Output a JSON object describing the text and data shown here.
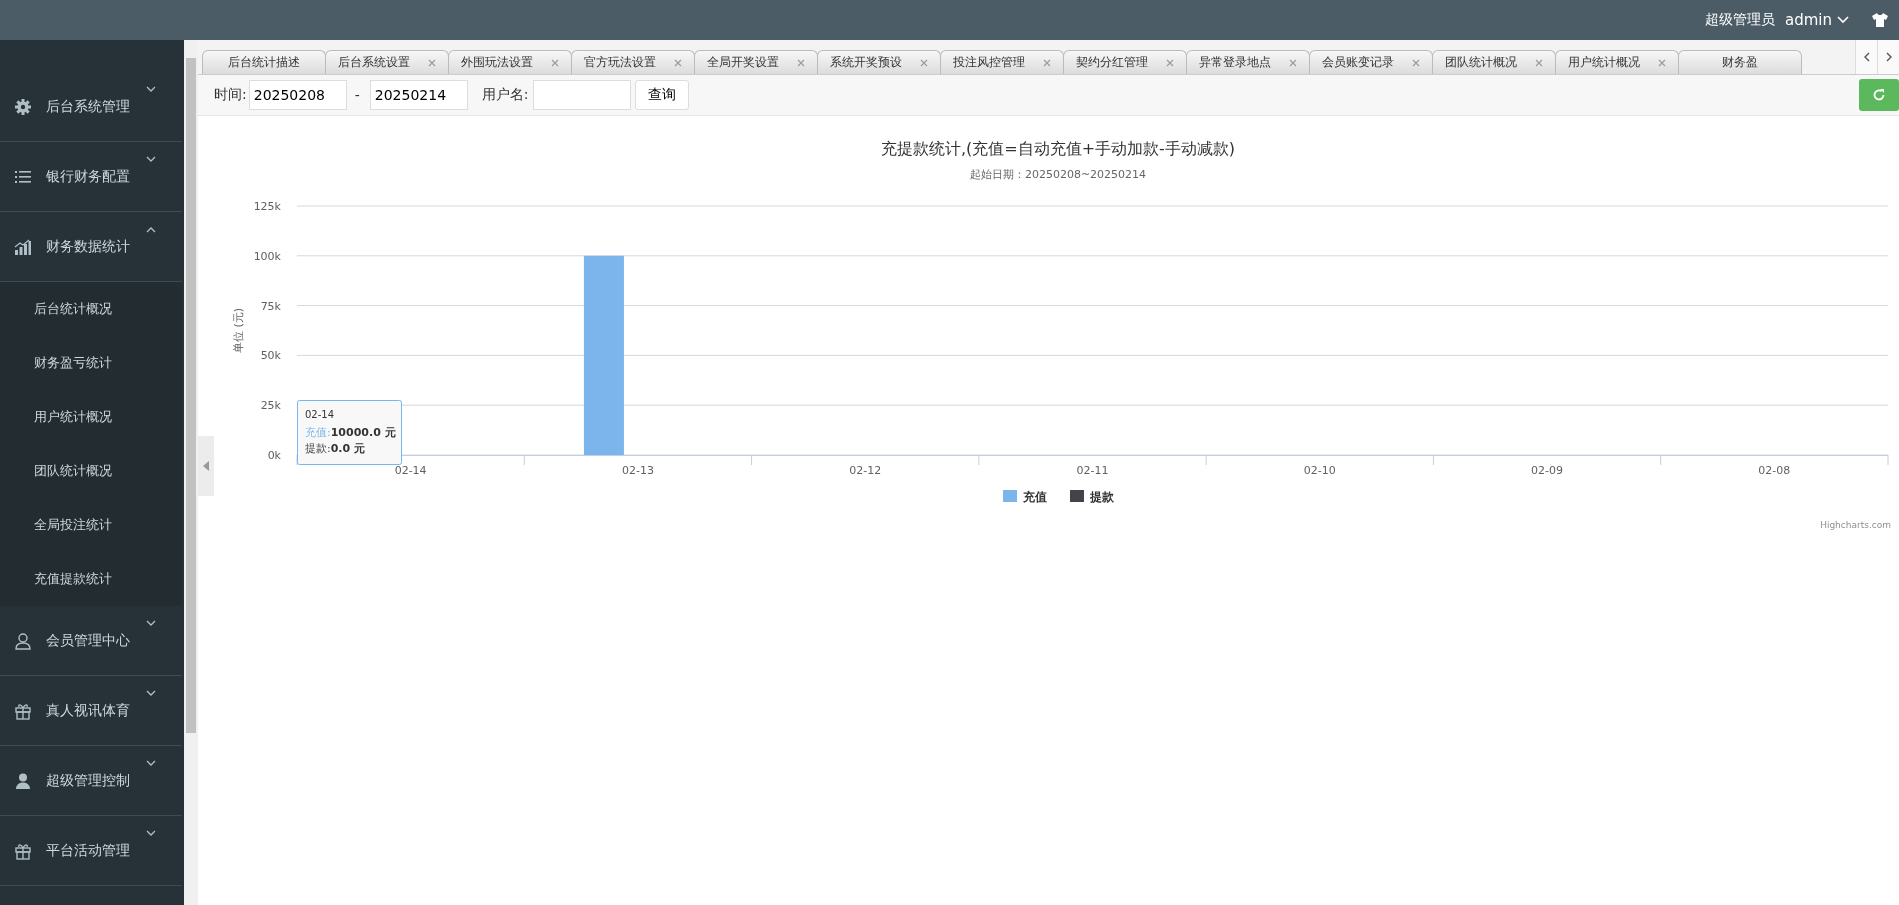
{
  "header": {
    "role": "超级管理员",
    "user": "admin"
  },
  "sidebar": {
    "items": [
      {
        "label": "后台系统管理",
        "expanded": false
      },
      {
        "label": "银行财务配置",
        "expanded": false
      },
      {
        "label": "财务数据统计",
        "expanded": true,
        "children": [
          {
            "label": "后台统计概况"
          },
          {
            "label": "财务盈亏统计"
          },
          {
            "label": "用户统计概况"
          },
          {
            "label": "团队统计概况"
          },
          {
            "label": "全局投注统计"
          },
          {
            "label": "充值提款统计"
          }
        ]
      },
      {
        "label": "会员管理中心",
        "expanded": false
      },
      {
        "label": "真人视讯体育",
        "expanded": false
      },
      {
        "label": "超级管理控制",
        "expanded": false
      },
      {
        "label": "平台活动管理",
        "expanded": false
      }
    ]
  },
  "tabs": [
    {
      "label": "后台统计描述",
      "closable": false,
      "selected": false
    },
    {
      "label": "后台系统设置",
      "closable": true,
      "selected": false
    },
    {
      "label": "外围玩法设置",
      "closable": true,
      "selected": false
    },
    {
      "label": "官方玩法设置",
      "closable": true,
      "selected": false
    },
    {
      "label": "全局开奖设置",
      "closable": true,
      "selected": false
    },
    {
      "label": "系统开奖预设",
      "closable": true,
      "selected": false
    },
    {
      "label": "投注风控管理",
      "closable": true,
      "selected": false
    },
    {
      "label": "契约分红管理",
      "closable": true,
      "selected": false
    },
    {
      "label": "异常登录地点",
      "closable": true,
      "selected": false
    },
    {
      "label": "会员账变记录",
      "closable": true,
      "selected": false
    },
    {
      "label": "团队统计概况",
      "closable": true,
      "selected": false
    },
    {
      "label": "用户统计概况",
      "closable": true,
      "selected": false
    },
    {
      "label": "财务盈",
      "closable": false,
      "selected": false
    }
  ],
  "filter": {
    "time_label": "时间:",
    "date_from": "20250208",
    "separator": "-",
    "date_to": "20250214",
    "username_label": "用户名:",
    "query_button": "查询"
  },
  "chart": {
    "subtitle": "起始日期：20250208~20250214",
    "credit": "Highcharts.com",
    "tooltip": {
      "title": "02-14",
      "lines": [
        {
          "label": "充值:",
          "value": "10000.0 元"
        },
        {
          "label": "提款:",
          "value": "0.0 元"
        }
      ]
    },
    "chart_data": {
      "type": "bar",
      "title": "充提款统计,(充值=自动充值+手动加款-手动减款)",
      "ylabel": "单位 (元)",
      "categories": [
        "02-14",
        "02-13",
        "02-12",
        "02-11",
        "02-10",
        "02-09",
        "02-08"
      ],
      "series": [
        {
          "name": "充值",
          "color": "#7cb5ec",
          "values": [
            0,
            100000,
            0,
            0,
            0,
            0,
            0
          ]
        },
        {
          "name": "提款",
          "color": "#434348",
          "values": [
            0,
            0,
            0,
            0,
            0,
            0,
            0
          ]
        }
      ],
      "ylim": [
        0,
        125000
      ],
      "grid": true,
      "yticks": [
        {
          "value": 0,
          "label": "0k"
        },
        {
          "value": 25000,
          "label": "25k"
        },
        {
          "value": 50000,
          "label": "50k"
        },
        {
          "value": 75000,
          "label": "75k"
        },
        {
          "value": 100000,
          "label": "100k"
        },
        {
          "value": 125000,
          "label": "125k"
        }
      ]
    }
  }
}
